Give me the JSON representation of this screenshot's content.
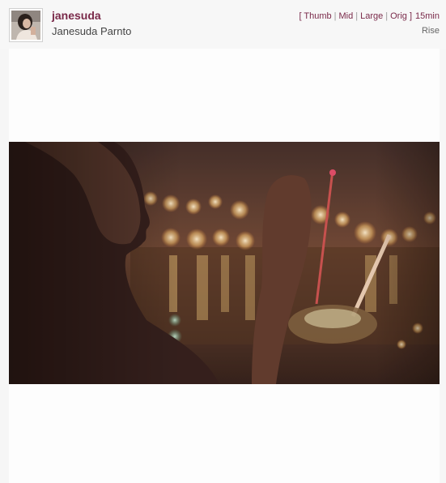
{
  "post": {
    "username": "janesuda",
    "full_name": "Janesuda Parnto",
    "time_ago": "15min",
    "filter": "Rise"
  },
  "sizes": {
    "open_bracket": "[",
    "close_bracket": "]",
    "thumb": "Thumb",
    "mid": "Mid",
    "large": "Large",
    "orig": "Orig",
    "separator": "|"
  },
  "icons": {
    "avatar": "user-avatar-photo"
  }
}
